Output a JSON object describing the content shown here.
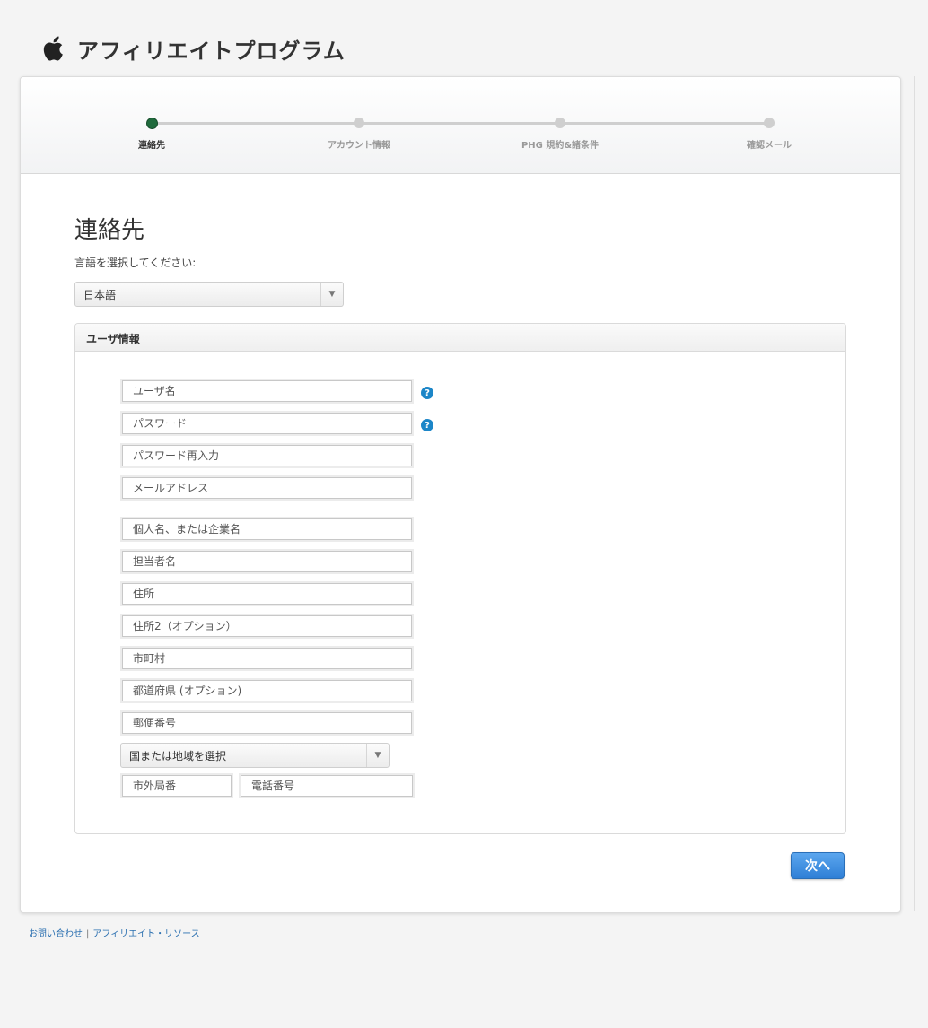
{
  "header": {
    "title": "アフィリエイトプログラム",
    "logo_icon": "apple-logo-icon"
  },
  "steps": [
    {
      "label": "連絡先",
      "active": true
    },
    {
      "label": "アカウント情報",
      "active": false
    },
    {
      "label": "PHG 規約&諸条件",
      "active": false
    },
    {
      "label": "確認メール",
      "active": false
    }
  ],
  "page": {
    "title": "連絡先",
    "language_prompt": "言語を選択してください:"
  },
  "language_select": {
    "value": "日本語"
  },
  "user_info": {
    "title": "ユーザ情報",
    "username": "ユーザ名",
    "password": "パスワード",
    "password_confirm": "パスワード再入力",
    "email": "メールアドレス",
    "name_or_company": "個人名、または企業名",
    "contact_person": "担当者名",
    "address": "住所",
    "address2": "住所2（オプション）",
    "city": "市町村",
    "state": "都道府県 (オプション)",
    "postal_code": "郵便番号",
    "country_select": "国または地域を選択",
    "area_code": "市外局番",
    "phone": "電話番号"
  },
  "actions": {
    "next_label": "次へ"
  },
  "footer": {
    "contact_link": "お問い合わせ",
    "separator": "|",
    "resources_link": "アフィリエイト・リソース"
  },
  "colors": {
    "accent": "#2f7fd6",
    "active_step": "#1f6a3c",
    "help_icon": "#1c86c8",
    "link": "#2a6fb0"
  }
}
